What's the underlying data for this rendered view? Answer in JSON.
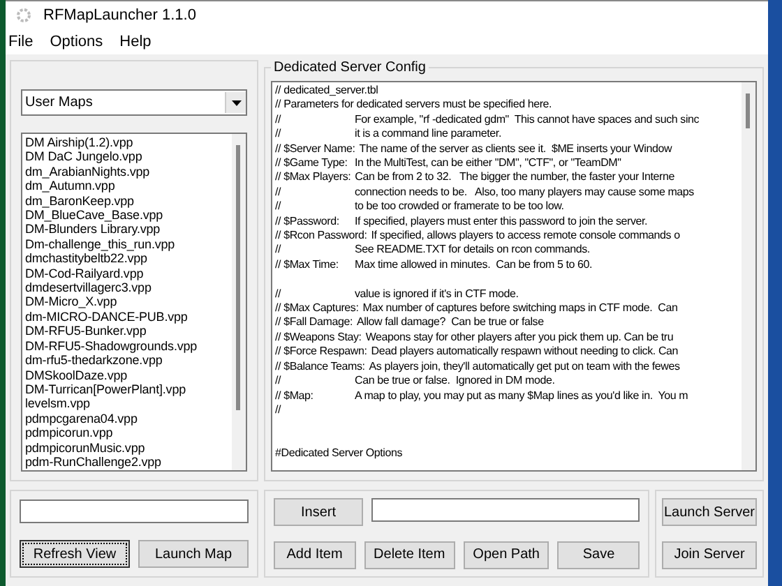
{
  "window": {
    "title": "RFMapLauncher 1.1.0"
  },
  "menu": [
    "File",
    "Options",
    "Help"
  ],
  "maps_panel": {
    "dropdown": "User Maps",
    "items": [
      {
        "label": "DM Airship(1.2).vpp",
        "selected": false
      },
      {
        "label": "DM DaC Jungelo.vpp",
        "selected": false
      },
      {
        "label": "dm_ArabianNights.vpp",
        "selected": false
      },
      {
        "label": "dm_Autumn.vpp",
        "selected": false
      },
      {
        "label": "dm_BaronKeep.vpp",
        "selected": false
      },
      {
        "label": "DM_BlueCave_Base.vpp",
        "selected": false
      },
      {
        "label": "DM-Blunders Library.vpp",
        "selected": false
      },
      {
        "label": "Dm-challenge_this_run.vpp",
        "selected": false
      },
      {
        "label": "dmchastitybeltb22.vpp",
        "selected": false
      },
      {
        "label": "DM-Cod-Railyard.vpp",
        "selected": false
      },
      {
        "label": "dmdesertvillagerc3.vpp",
        "selected": false
      },
      {
        "label": "DM-Micro_X.vpp",
        "selected": false
      },
      {
        "label": "dm-MICRO-DANCE-PUB.vpp",
        "selected": false
      },
      {
        "label": "DM-RFU5-Bunker.vpp",
        "selected": false
      },
      {
        "label": "DM-RFU5-Shadowgrounds.vpp",
        "selected": false
      },
      {
        "label": "dm-rfu5-thedarkzone.vpp",
        "selected": false
      },
      {
        "label": "DMSkoolDaze.vpp",
        "selected": false
      },
      {
        "label": "DM-Turrican[PowerPlant].vpp",
        "selected": false
      },
      {
        "label": "levelsm.vpp",
        "selected": false
      },
      {
        "label": "pdmpcgarena04.vpp",
        "selected": false
      },
      {
        "label": "pdmpicorun.vpp",
        "selected": false
      },
      {
        "label": "pdmpicorunMusic.vpp",
        "selected": false
      },
      {
        "label": "pdm-RunChallenge2.vpp",
        "selected": false
      }
    ]
  },
  "config_panel": {
    "title": "Dedicated Server Config",
    "lines": [
      {
        "kind": "comment",
        "text": "// dedicated_server.tbl"
      },
      {
        "kind": "comment",
        "text": "// Parameters for dedicated servers must be specified here."
      },
      {
        "kind": "field",
        "label": "//",
        "text": "For example, \"rf -dedicated gdm\"  This cannot have spaces and such sinc"
      },
      {
        "kind": "field",
        "label": "//",
        "text": "it is a command line parameter."
      },
      {
        "kind": "field",
        "label": "// $Server Name:",
        "text": "The name of the server as clients see it.  $ME inserts your Window"
      },
      {
        "kind": "field",
        "label": "// $Game Type:",
        "text": "In the MultiTest, can be either \"DM\", \"CTF\", or \"TeamDM\""
      },
      {
        "kind": "field",
        "label": "// $Max Players:",
        "text": "Can be from 2 to 32.   The bigger the number, the faster your Interne"
      },
      {
        "kind": "field",
        "label": "//",
        "text": "connection needs to be.   Also, too many players may cause some maps"
      },
      {
        "kind": "field",
        "label": "//",
        "text": "to be too crowded or framerate to be too low."
      },
      {
        "kind": "field",
        "label": "// $Password:",
        "text": "If specified, players must enter this password to join the server."
      },
      {
        "kind": "field",
        "label": "// $Rcon Password:",
        "text": "If specified, allows players to access remote console commands o"
      },
      {
        "kind": "field",
        "label": "//",
        "text": "See README.TXT for details on rcon commands."
      },
      {
        "kind": "field",
        "label": "// $Max Time:",
        "text": "Max time allowed in minutes.  Can be from 5 to 60."
      },
      {
        "kind": "blank"
      },
      {
        "kind": "field",
        "label": "//",
        "text": "value is ignored if it's in CTF mode."
      },
      {
        "kind": "field",
        "label": "// $Max Captures:",
        "text": "Max number of captures before switching maps in CTF mode.  Can"
      },
      {
        "kind": "field",
        "label": "// $Fall Damage:",
        "text": "Allow fall damage?  Can be true or false"
      },
      {
        "kind": "field",
        "label": "// $Weapons Stay:",
        "text": "Weapons stay for other players after you pick them up. Can be tru"
      },
      {
        "kind": "field",
        "label": "// $Force Respawn:",
        "text": "Dead players automatically respawn without needing to click. Can"
      },
      {
        "kind": "field",
        "label": "// $Balance Teams:",
        "text": "As players join, they'll automatically get put on team with the fewes"
      },
      {
        "kind": "field",
        "label": "//",
        "text": "Can be true or false.  Ignored in DM mode."
      },
      {
        "kind": "field",
        "label": "// $Map:",
        "text": "A map to play, you may put as many $Map lines as you'd like in.  You m"
      },
      {
        "kind": "comment",
        "text": "//"
      },
      {
        "kind": "blank"
      },
      {
        "kind": "blank"
      },
      {
        "kind": "comment",
        "text": "#Dedicated Server Options"
      }
    ]
  },
  "map_actions": {
    "buttons": [
      {
        "label": "Refresh View",
        "focused": true
      },
      {
        "label": "Launch Map",
        "focused": false
      }
    ]
  },
  "config_actions": {
    "insert": "Insert",
    "buttons": [
      "Add Item",
      "Delete Item",
      "Open Path",
      "Save"
    ]
  },
  "server_actions": {
    "buttons": [
      "Launch Server",
      "Join Server"
    ]
  }
}
